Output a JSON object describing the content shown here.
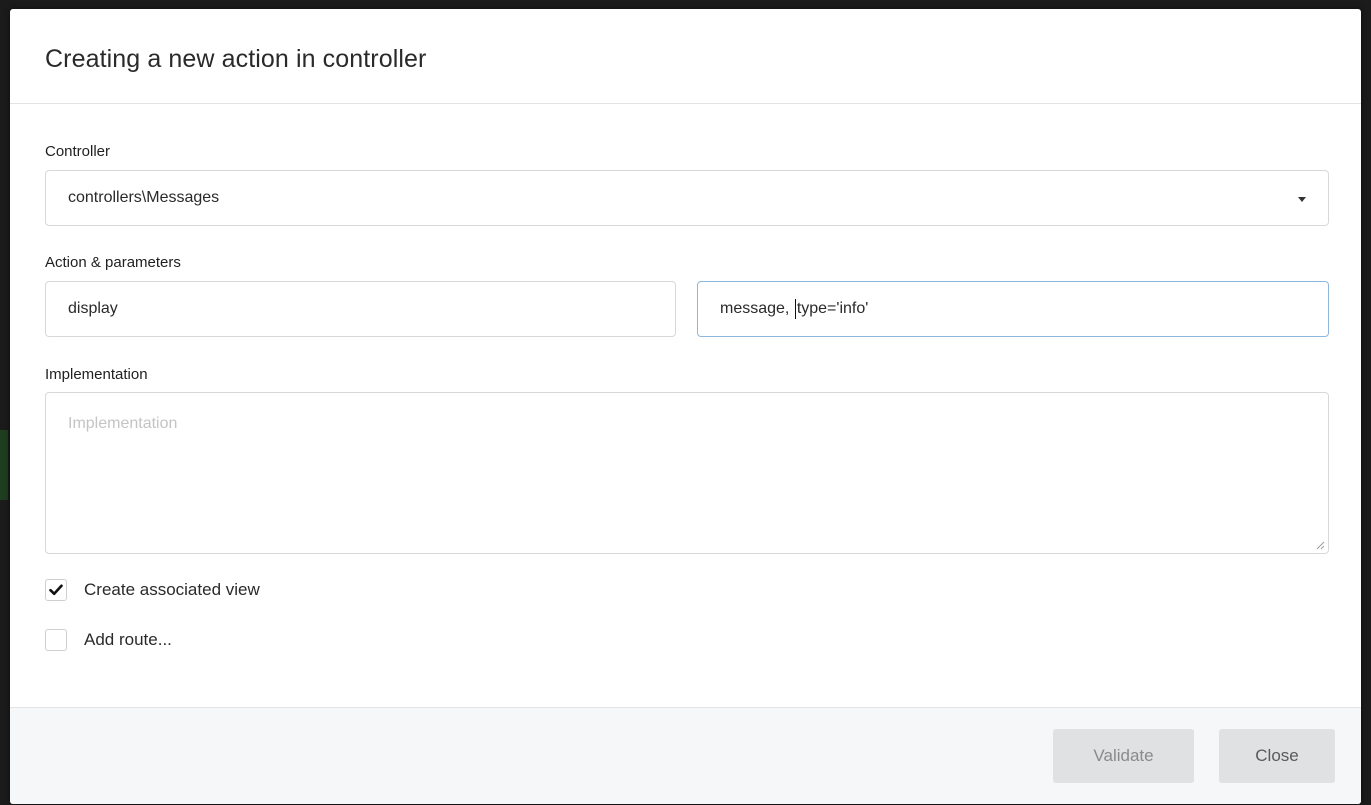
{
  "dialog": {
    "title": "Creating a new action in controller"
  },
  "form": {
    "controller": {
      "label": "Controller",
      "selected": "controllers\\Messages"
    },
    "action": {
      "label": "Action & parameters",
      "name_value": "display",
      "params_before_caret": "message, ",
      "params_after_caret": "type='info'"
    },
    "implementation": {
      "label": "Implementation",
      "placeholder": "Implementation",
      "value": ""
    },
    "options": [
      {
        "label": "Create associated view",
        "checked": true
      },
      {
        "label": "Add route...",
        "checked": false
      }
    ]
  },
  "footer": {
    "validate_label": "Validate",
    "close_label": "Close"
  },
  "colors": {
    "focus_border": "#8fb7de",
    "footer_bg": "#f6f7f9",
    "button_bg": "#e0e1e2"
  }
}
